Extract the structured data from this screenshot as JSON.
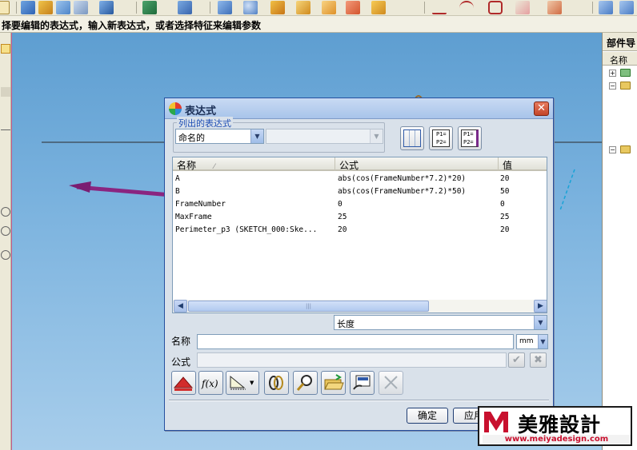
{
  "status": {
    "prompt": "择要编辑的表达式，输入新表达式，或者选择特征来编辑参数"
  },
  "nav_panel": {
    "title": "部件导",
    "column": "名称"
  },
  "toolbar": {
    "icons": [
      "sketch-icon",
      "extrude-icon",
      "revolve-icon",
      "sweep-icon",
      "datum-icon",
      "feature-icon",
      "block-icon",
      "cylinder-icon",
      "cone-icon",
      "sphere-icon",
      "curve-icon",
      "arc-icon",
      "spline-icon",
      "edit-curve-icon",
      "shade-icon"
    ]
  },
  "dialog": {
    "title": "表达式",
    "close_label": "✕",
    "list_group_label": "列出的表达式",
    "list_filter_value": "命名的",
    "list_secondary_value": "",
    "table": {
      "columns": [
        "名称",
        "公式",
        "值"
      ],
      "rows": [
        {
          "name": "A",
          "formula": "abs(cos(FrameNumber*7.2)*20)",
          "value": "20"
        },
        {
          "name": "B",
          "formula": "abs(cos(FrameNumber*7.2)*50)",
          "value": "50"
        },
        {
          "name": "FrameNumber",
          "formula": "0",
          "value": "0"
        },
        {
          "name": "MaxFrame",
          "formula": "25",
          "value": "25"
        },
        {
          "name": "Perimeter_p3   (SKETCH_000:Ske...",
          "formula": "20",
          "value": "20"
        }
      ]
    },
    "type_value": "长度",
    "name_label": "名称",
    "name_value": "",
    "unit_value": "mm",
    "formula_label": "公式",
    "formula_value": "",
    "ok_label": "确定",
    "apply_label": "应用"
  },
  "watermark": {
    "brand": "美雅設計",
    "url": "www.meiyadesign.com"
  },
  "colors": {
    "titlebar": "#a8c4ea",
    "dialog_bg": "#d9e1ea",
    "close": "#c3452a",
    "viewport_top": "#5e9ed1",
    "viewport_bottom": "#a7cdeb",
    "legend_text": "#1f4fb5",
    "watermark_red": "#c8102e"
  }
}
